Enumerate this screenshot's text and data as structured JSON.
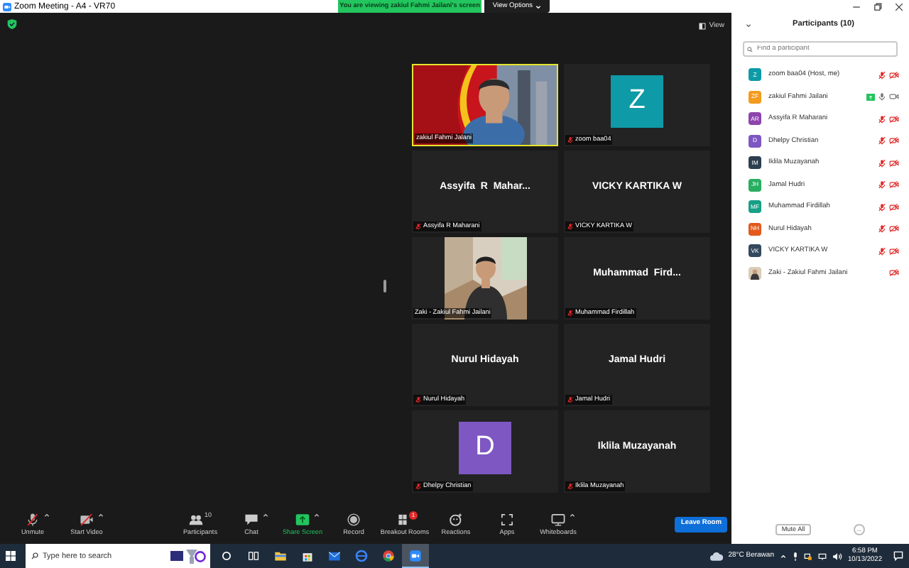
{
  "window": {
    "title": "Zoom Meeting - A4 - VR70"
  },
  "banner": {
    "text": "You are viewing zakiul Fahmi Jailani's screen",
    "button": "View Options"
  },
  "view_button": "View",
  "tiles": [
    {
      "kind": "video_wide",
      "label": "zakiul Fahmi Jalani",
      "muted": false,
      "speaking": true
    },
    {
      "kind": "avatar",
      "initial": "Z",
      "color": "#0e9aa7",
      "label": "zoom baa04",
      "muted": true,
      "speaking": false
    },
    {
      "kind": "name",
      "name": "Assyifa  R  Mahar...",
      "label": "Assyifa R Maharani",
      "muted": true,
      "speaking": false
    },
    {
      "kind": "name",
      "name": "VICKY KARTIKA W",
      "label": "VICKY KARTIKA W",
      "muted": true,
      "speaking": false
    },
    {
      "kind": "video",
      "label": "Zaki - Zakiul Fahmi Jailani",
      "muted": false,
      "speaking": false
    },
    {
      "kind": "name",
      "name": "Muhammad  Fird...",
      "label": "Muhammad Firdillah",
      "muted": true,
      "speaking": false
    },
    {
      "kind": "name",
      "name": "Nurul Hidayah",
      "label": "Nurul Hidayah",
      "muted": true,
      "speaking": false
    },
    {
      "kind": "name",
      "name": "Jamal Hudri",
      "label": "Jamal Hudri",
      "muted": true,
      "speaking": false
    },
    {
      "kind": "avatar",
      "initial": "D",
      "color": "#7e57c2",
      "label": "Dhelpy Christian",
      "muted": true,
      "speaking": false
    },
    {
      "kind": "name",
      "name": "Iklila Muzayanah",
      "label": "Iklila Muzayanah",
      "muted": true,
      "speaking": false
    }
  ],
  "toolbar": [
    {
      "kind": "mic",
      "label": "Unmute",
      "caret": true
    },
    {
      "kind": "video",
      "label": "Start Video",
      "caret": true
    },
    {
      "kind": "participants",
      "label": "Participants",
      "count": "10",
      "caret": false
    },
    {
      "kind": "chat",
      "label": "Chat",
      "caret": true
    },
    {
      "kind": "share",
      "label": "Share Screen",
      "caret": true
    },
    {
      "kind": "record",
      "label": "Record",
      "caret": false
    },
    {
      "kind": "breakout",
      "label": "Breakout Rooms",
      "badge": "1",
      "caret": false
    },
    {
      "kind": "reactions",
      "label": "Reactions",
      "caret": false
    },
    {
      "kind": "apps",
      "label": "Apps",
      "caret": false
    },
    {
      "kind": "whiteboard",
      "label": "Whiteboards",
      "caret": true
    }
  ],
  "leave_button": "Leave Room",
  "participants": {
    "title": "Participants (10)",
    "search": {
      "placeholder": "Find a participant"
    },
    "items": [
      {
        "kind": "initials",
        "initials": "Z",
        "color": "#0e9aa7",
        "name": "zoom baa04 (Host, me)",
        "audio": true,
        "muted": true,
        "sharing": false,
        "video_off": true
      },
      {
        "kind": "initials",
        "initials": "ZF",
        "color": "#f29b1d",
        "name": "zakiul Fahmi Jailani",
        "audio": true,
        "muted": false,
        "sharing": true,
        "video_off": false
      },
      {
        "kind": "initials",
        "initials": "AR",
        "color": "#8e44ad",
        "name": "Assyifa R Maharani",
        "audio": true,
        "muted": true,
        "sharing": false,
        "video_off": true
      },
      {
        "kind": "initials",
        "initials": "D",
        "color": "#7e57c2",
        "name": "Dhelpy Christian",
        "audio": true,
        "muted": true,
        "sharing": false,
        "video_off": true
      },
      {
        "kind": "initials",
        "initials": "IM",
        "color": "#2c3e50",
        "name": "Iklila Muzayanah",
        "audio": true,
        "muted": true,
        "sharing": false,
        "video_off": true
      },
      {
        "kind": "initials",
        "initials": "JH",
        "color": "#27ae60",
        "name": "Jamal Hudri",
        "audio": true,
        "muted": true,
        "sharing": false,
        "video_off": true
      },
      {
        "kind": "initials",
        "initials": "MF",
        "color": "#16a085",
        "name": "Muhammad Firdillah",
        "audio": true,
        "muted": true,
        "sharing": false,
        "video_off": true
      },
      {
        "kind": "initials",
        "initials": "NH",
        "color": "#e2591b",
        "name": "Nurul Hidayah",
        "audio": true,
        "muted": true,
        "sharing": false,
        "video_off": true
      },
      {
        "kind": "initials",
        "initials": "VK",
        "color": "#34495e",
        "name": "VICKY KARTIKA W",
        "audio": true,
        "muted": true,
        "sharing": false,
        "video_off": true
      },
      {
        "name": "Zaki - Zakiul Fahmi Jailani",
        "audio": false,
        "sharing": false,
        "video_off": true
      }
    ],
    "mute_all": "Mute All",
    "more": "..."
  },
  "taskbar": {
    "search": {
      "placeholder": "Type here to search"
    },
    "apps": [
      {
        "kind": "cortana",
        "selected": false
      },
      {
        "kind": "taskview",
        "selected": false
      },
      {
        "kind": "explorer",
        "selected": false
      },
      {
        "kind": "store",
        "selected": false
      },
      {
        "kind": "mail",
        "selected": false
      },
      {
        "kind": "edge",
        "selected": false
      },
      {
        "kind": "chrome",
        "selected": false
      },
      {
        "kind": "zoom",
        "selected": true
      }
    ],
    "weather": "28°C Berawan",
    "time": "6:58 PM",
    "date": "10/13/2022"
  }
}
